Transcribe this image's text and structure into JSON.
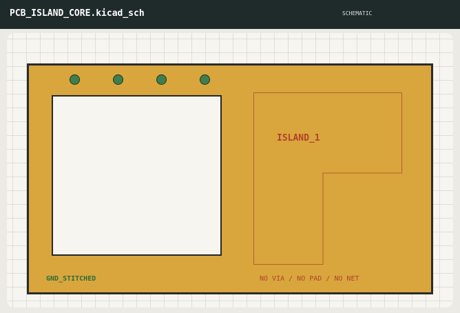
{
  "window": {
    "title": "PCB_ISLAND_CORE.kicad_sch",
    "mode_label": "SCHEMATIC"
  },
  "board": {
    "fill_color": "#d8a63d",
    "outline_color": "#2b2b2b",
    "vias": [
      {
        "name": "via-1",
        "color": "#3e7f4d"
      },
      {
        "name": "via-2",
        "color": "#3e7f4d"
      },
      {
        "name": "via-3",
        "color": "#3e7f4d"
      },
      {
        "name": "via-4",
        "color": "#3e7f4d"
      }
    ],
    "island_label": "ISLAND_1",
    "gnd_label": "GND_STITCHED",
    "rule_label": "NO VIA / NO PAD / NO NET"
  },
  "colors": {
    "titlebar": "#1f2a2a",
    "canvas": "#f6f5f0",
    "island_text": "#b3412b",
    "gnd_text": "#2f6b3a"
  }
}
